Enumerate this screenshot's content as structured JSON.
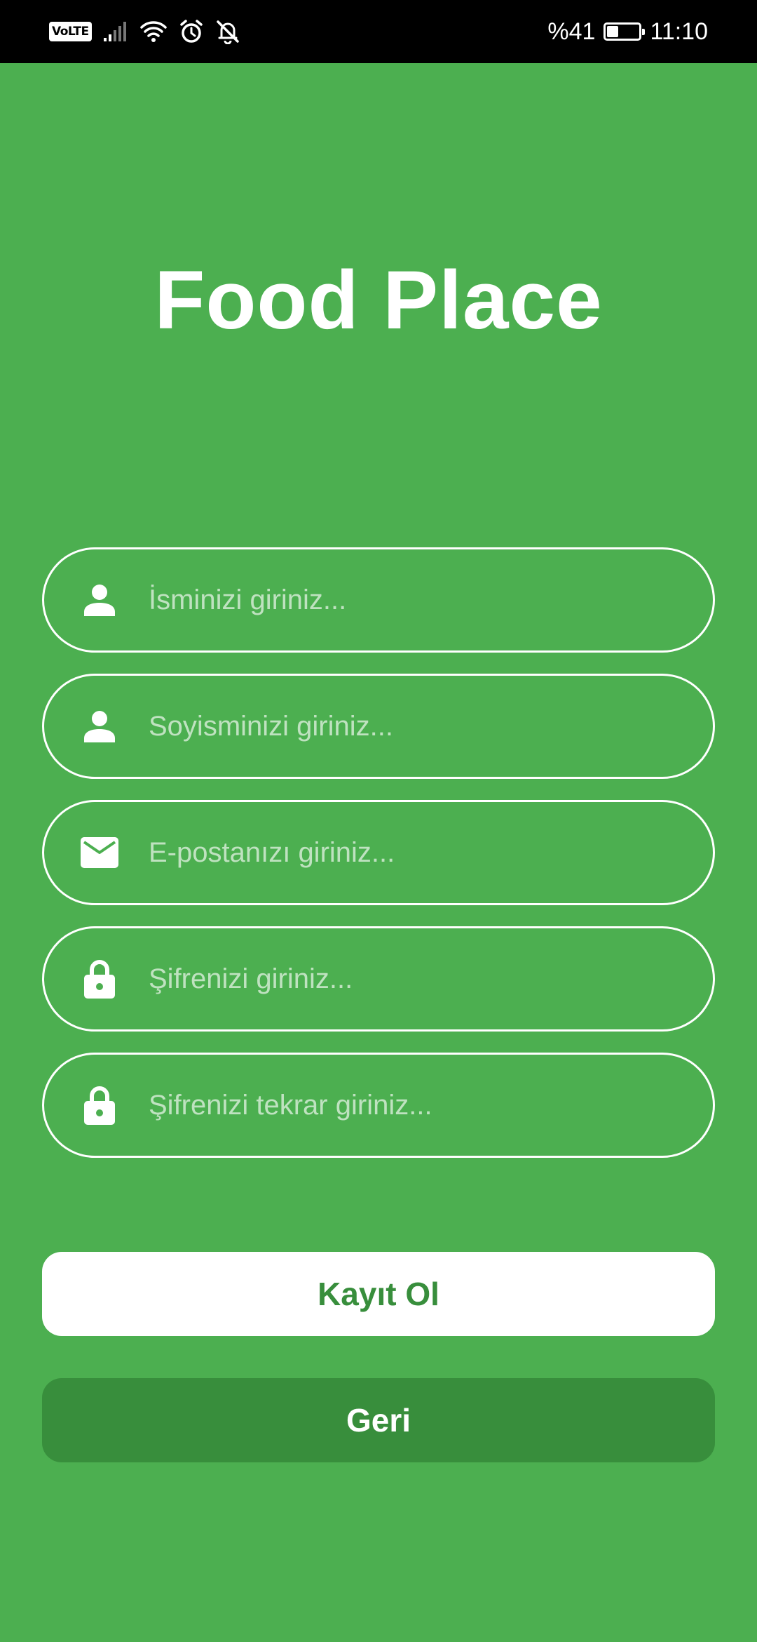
{
  "status_bar": {
    "network_badge": "VoLTE",
    "battery_text": "%41",
    "battery_level": 0.41,
    "time": "11:10",
    "icons": [
      "signal-icon",
      "wifi-icon",
      "alarm-icon",
      "notifications-off-icon",
      "battery-charging-icon"
    ]
  },
  "app": {
    "title": "Food Place"
  },
  "form": {
    "first_name": {
      "placeholder": "İsminizi giriniz...",
      "value": "",
      "icon": "person-icon"
    },
    "last_name": {
      "placeholder": "Soyisminizi giriniz...",
      "value": "",
      "icon": "person-icon"
    },
    "email": {
      "placeholder": "E-postanızı giriniz...",
      "value": "",
      "icon": "mail-icon"
    },
    "password": {
      "placeholder": "Şifrenizi giriniz...",
      "value": "",
      "icon": "lock-icon"
    },
    "password_repeat": {
      "placeholder": "Şifrenizi tekrar giriniz...",
      "value": "",
      "icon": "lock-icon"
    }
  },
  "buttons": {
    "register_label": "Kayıt Ol",
    "back_label": "Geri"
  },
  "colors": {
    "background": "#4caf50",
    "button_dark": "#388e3c",
    "button_light": "#ffffff",
    "placeholder": "#bfe2c0",
    "status_bar": "#000000"
  }
}
